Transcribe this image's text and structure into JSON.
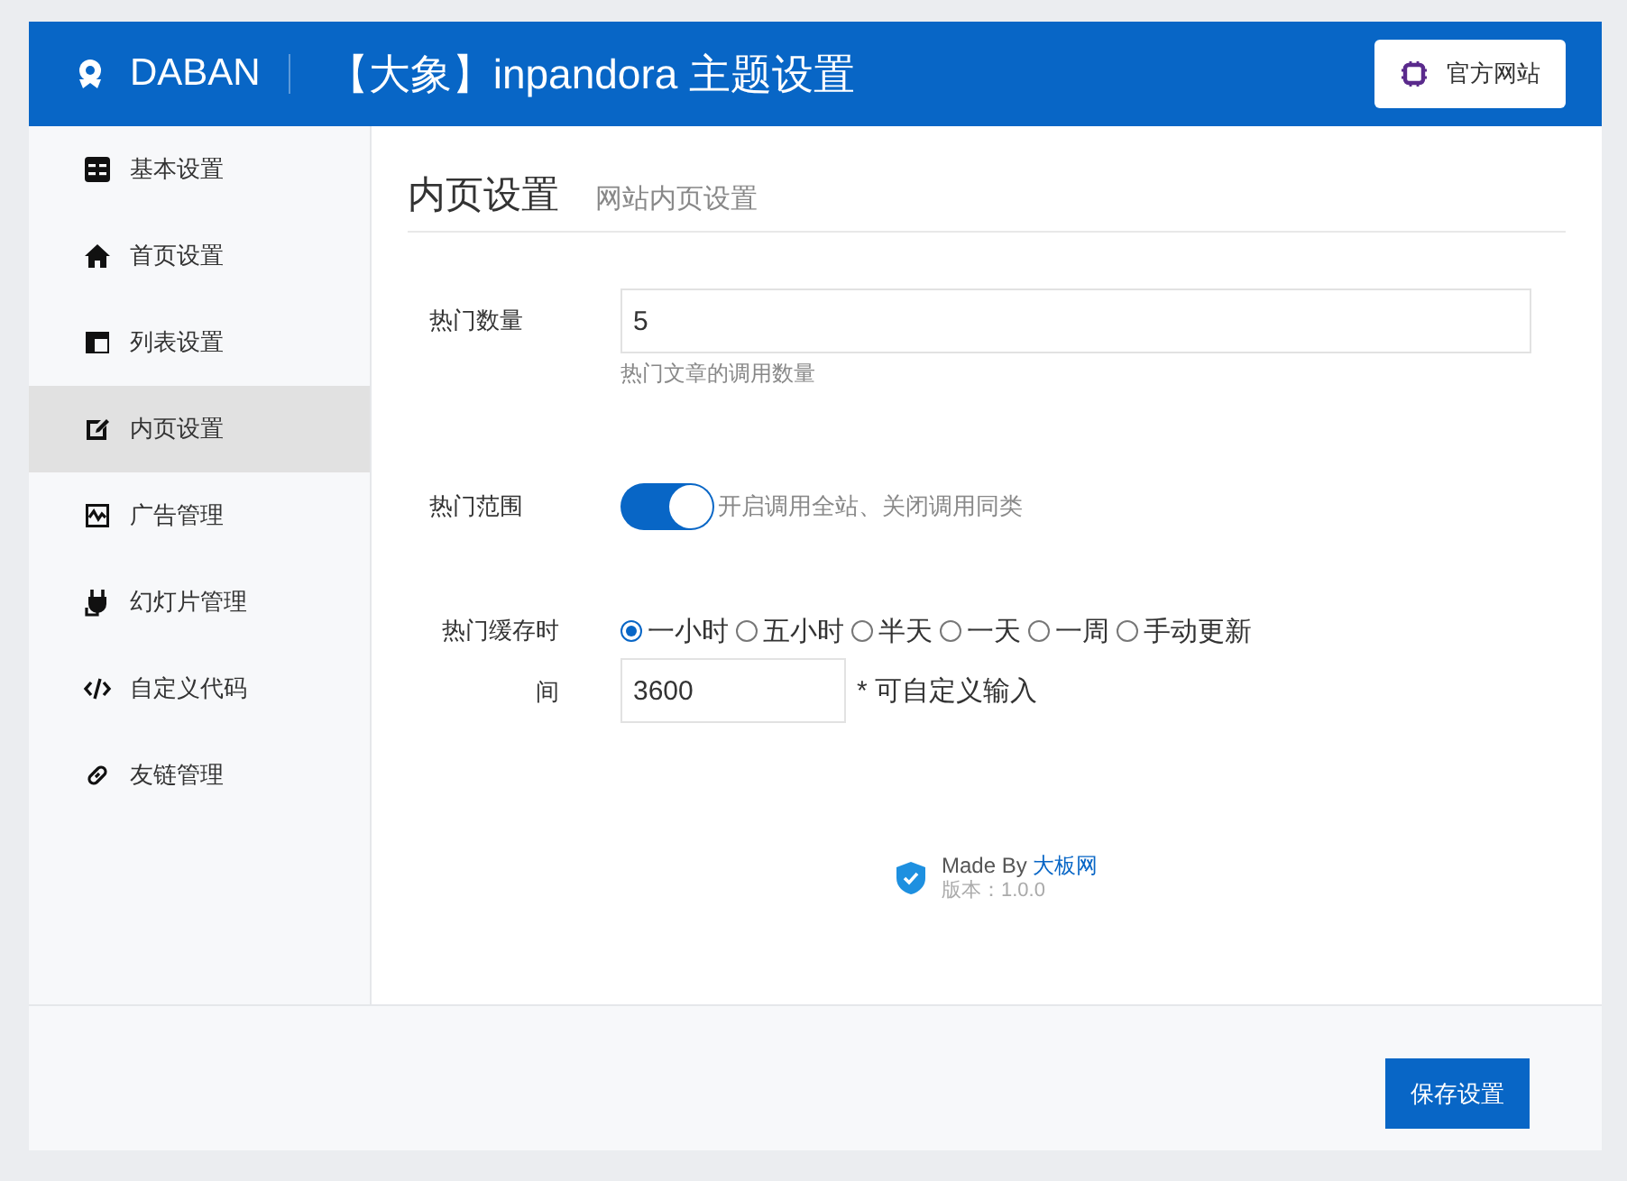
{
  "header": {
    "brand": "DABAN",
    "title": "【大象】inpandora 主题设置",
    "site_button": "官方网站"
  },
  "sidebar": {
    "items": [
      {
        "label": "基本设置",
        "selected": false
      },
      {
        "label": "首页设置",
        "selected": false
      },
      {
        "label": "列表设置",
        "selected": false
      },
      {
        "label": "内页设置",
        "selected": true
      },
      {
        "label": "广告管理",
        "selected": false
      },
      {
        "label": "幻灯片管理",
        "selected": false
      },
      {
        "label": "自定义代码",
        "selected": false
      },
      {
        "label": "友链管理",
        "selected": false
      }
    ]
  },
  "section": {
    "title": "内页设置",
    "subtitle": "网站内页设置"
  },
  "fields": [
    {
      "kind": "text",
      "label": "热门数量",
      "value": "5",
      "help": "热门文章的调用数量"
    },
    {
      "kind": "switch",
      "label": "热门范围",
      "on": true,
      "hint": "开启调用全站、关闭调用同类"
    },
    {
      "kind": "radio",
      "label": "热门缓存时间",
      "options": [
        {
          "label": "一小时",
          "selected": true
        },
        {
          "label": "五小时",
          "selected": false
        },
        {
          "label": "半天",
          "selected": false
        },
        {
          "label": "一天",
          "selected": false
        },
        {
          "label": "一周",
          "selected": false
        },
        {
          "label": "手动更新",
          "selected": false
        }
      ],
      "value": "3600",
      "note": "* 可自定义输入"
    }
  ],
  "credit": {
    "made_by": "Made By",
    "author": "大板网",
    "version": "版本：1.0.0"
  },
  "footer": {
    "save_button": "保存设置"
  }
}
